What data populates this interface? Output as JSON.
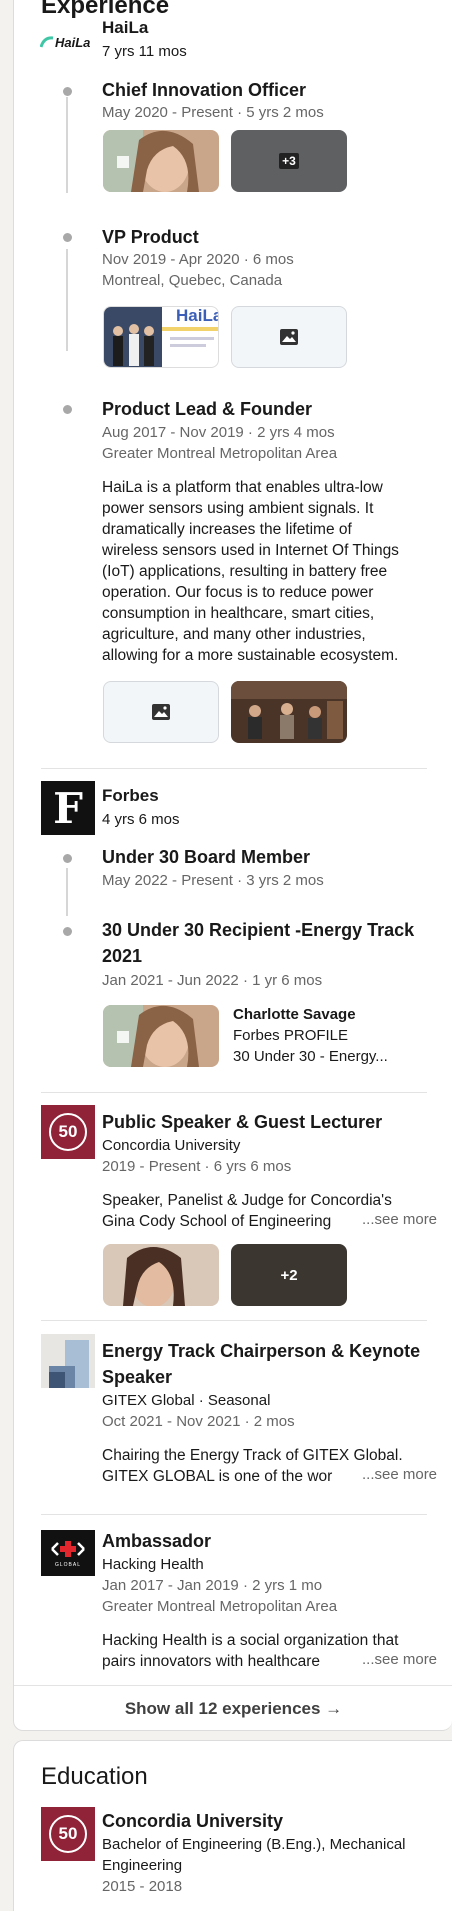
{
  "experience": {
    "title": "Experience",
    "haila": {
      "logo_text": "HaiLa",
      "name": "HaiLa",
      "duration": "7 yrs 11 mos",
      "roles": [
        {
          "title": "Chief Innovation Officer",
          "dates": "May 2020 - Present · 5 yrs 2 mos",
          "more_count": "+3"
        },
        {
          "title": "VP Product",
          "dates": "Nov 2019 - Apr 2020 · 6 mos",
          "location": "Montreal, Quebec, Canada",
          "media_text": "HaiLa"
        },
        {
          "title": "Product Lead & Founder",
          "dates": "Aug 2017 - Nov 2019 · 2 yrs 4 mos",
          "location": "Greater Montreal Metropolitan Area",
          "description": [
            "HaiLa is a platform that enables ultra-low",
            "power sensors using ambient signals. It",
            "dramatically increases the lifetime of",
            "wireless sensors used in Internet Of Things",
            "(IoT) applications, resulting in battery free",
            "operation. Our focus is to reduce power",
            "consumption in healthcare, smart cities,",
            "agriculture, and many other industries,",
            "allowing for a more sustainable ecosystem."
          ]
        }
      ]
    },
    "forbes": {
      "logo_letter": "F",
      "name": "Forbes",
      "duration": "4 yrs 6 mos",
      "roles": [
        {
          "title": "Under 30 Board Member",
          "dates": "May 2022 - Present · 3 yrs 2 mos"
        },
        {
          "title_line1": "30 Under 30 Recipient -Energy Track",
          "title_line2": "2021",
          "dates": "Jan 2021 - Jun 2022 · 1 yr 6 mos",
          "media_title": "Charlotte Savage",
          "media_sub1": "Forbes PROFILE",
          "media_sub2": "30 Under 30 - Energy..."
        }
      ]
    },
    "concordia_speaker": {
      "logo_text": "50",
      "title": "Public Speaker & Guest Lecturer",
      "org": "Concordia University",
      "dates": "2019 - Present · 6 yrs 6 mos",
      "desc_line1": "Speaker, Panelist & Judge for Concordia's",
      "desc_line2": "Gina Cody School of Engineering",
      "see_more": "...see more",
      "more_count": "+2"
    },
    "gitex": {
      "title_line1": "Energy Track Chairperson & Keynote",
      "title_line2": "Speaker",
      "org": "GITEX Global · Seasonal",
      "dates": "Oct 2021 - Nov 2021 · 2 mos",
      "desc_line1": "Chairing the Energy Track of GITEX Global.",
      "desc_line2": "GITEX GLOBAL is one of the wor",
      "see_more": "...see more"
    },
    "hacking_health": {
      "logo_text": "GLOBAL",
      "title": "Ambassador",
      "org": "Hacking Health",
      "dates": "Jan 2017 - Jan 2019 · 2 yrs 1 mo",
      "location": "Greater Montreal Metropolitan Area",
      "desc_line1": "Hacking Health is a social organization that",
      "desc_line2": "pairs innovators with healthcare",
      "see_more": "...see more"
    },
    "show_all": "Show all 12 experiences →"
  },
  "education": {
    "title": "Education",
    "school": "Concordia University",
    "logo_text": "50",
    "degree_line1": "Bachelor of Engineering (B.Eng.), Mechanical",
    "degree_line2": "Engineering",
    "dates": "2015 - 2018"
  },
  "colors": {
    "page_bg": "#f4f2ee",
    "concordia_red": "#912338",
    "haila_green": "#3fc7a5",
    "placeholder_bg": "#f3f6f8"
  }
}
